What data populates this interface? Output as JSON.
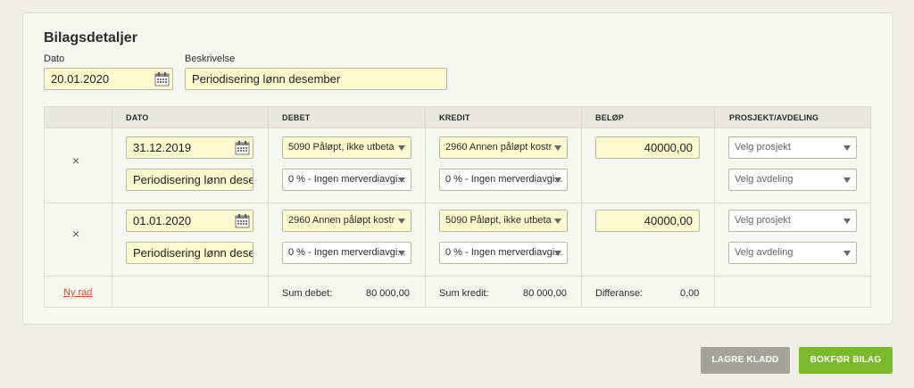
{
  "header": {
    "title": "Bilagsdetaljer",
    "date_label": "Dato",
    "date_value": "20.01.2020",
    "desc_label": "Beskrivelse",
    "desc_value": "Periodisering lønn desember"
  },
  "columns": [
    "DATO",
    "DEBET",
    "KREDIT",
    "BELØP",
    "PROSJEKT/AVDELING"
  ],
  "remove_glyph": "×",
  "rows": [
    {
      "date": "31.12.2019",
      "description": "Periodisering lønn desen",
      "debet_account": "5090 Påløpt, ikke utbeta",
      "debet_vat": "0 % - Ingen merverdiavgi...",
      "kredit_account": "2960 Annen påløpt kostr",
      "kredit_vat": "0 % - Ingen merverdiavgi...",
      "amount": "40000,00",
      "project_placeholder": "Velg prosjekt",
      "department_placeholder": "Velg avdeling"
    },
    {
      "date": "01.01.2020",
      "description": "Periodisering lønn desen",
      "debet_account": "2960 Annen påløpt kostr",
      "debet_vat": "0 % - Ingen merverdiavgi...",
      "kredit_account": "5090 Påløpt, ikke utbeta",
      "kredit_vat": "0 % - Ingen merverdiavgi...",
      "amount": "40000,00",
      "project_placeholder": "Velg prosjekt",
      "department_placeholder": "Velg avdeling"
    }
  ],
  "footer": {
    "new_row": "Ny rad",
    "sum_debet_label": "Sum debet:",
    "sum_debet_value": "80 000,00",
    "sum_kredit_label": "Sum kredit:",
    "sum_kredit_value": "80 000,00",
    "diff_label": "Differanse:",
    "diff_value": "0,00"
  },
  "actions": {
    "save_draft": "LAGRE KLADD",
    "book": "BOKFØR BILAG"
  },
  "colors": {
    "field_bg": "#fbfbcf",
    "accent_green": "#7ab82c",
    "link_orange": "#d0502a"
  }
}
